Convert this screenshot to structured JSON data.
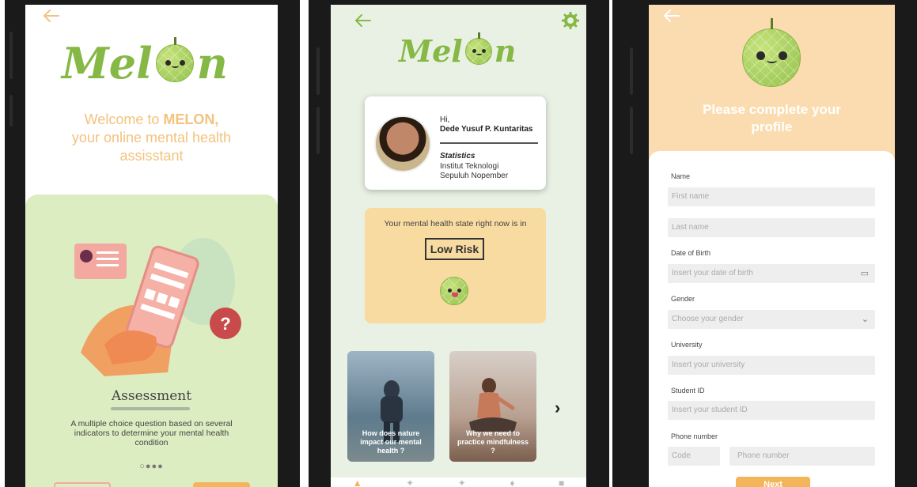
{
  "screen1": {
    "back_icon": "arrow-left-icon",
    "logo_prefix": "Mel",
    "logo_suffix": "n",
    "welcome_line1": "Welcome to ",
    "welcome_brand": "MELON,",
    "welcome_line2": "your online mental health",
    "welcome_line3": "assisstant",
    "card_title": "Assessment",
    "card_desc": "A multiple choice question based on several indicators to determine your mental health condition",
    "pager_dots": "○●●●"
  },
  "screen2": {
    "back_icon": "arrow-left-icon",
    "settings_icon": "gear-icon",
    "logo_prefix": "Mel",
    "logo_suffix": "n",
    "greeting": "Hi,",
    "user_name": "Dede Yusuf P. Kuntaritas",
    "department": "Statistics",
    "institution_line1": "Institut Teknologi",
    "institution_line2": "Sepuluh Nopember",
    "state_text": "Your mental health state right now is in",
    "risk_level": "Low Risk",
    "articles": [
      {
        "caption": "How does nature impact our mental health ?"
      },
      {
        "caption": "Why we need to practice mindfulness ?"
      }
    ],
    "next_arrow": "›"
  },
  "screen3": {
    "back_icon": "arrow-left-icon",
    "title": "Please complete your profile",
    "name_label": "Name",
    "first_name_placeholder": "First name",
    "last_name_placeholder": "Last name",
    "dob_label": "Date of Birth",
    "dob_placeholder": "Insert your date of birth",
    "gender_label": "Gender",
    "gender_placeholder": "Choose your gender",
    "university_label": "University",
    "university_placeholder": "Insert your university",
    "student_id_label": "Student ID",
    "student_id_placeholder": "Insert your student ID",
    "phone_label": "Phone number",
    "code_placeholder": "Code",
    "phone_placeholder": "Phone number",
    "next_label": "Next"
  },
  "colors": {
    "brand_green": "#86b846",
    "accent_orange": "#f3b45a",
    "peach": "#fbdcb0"
  }
}
